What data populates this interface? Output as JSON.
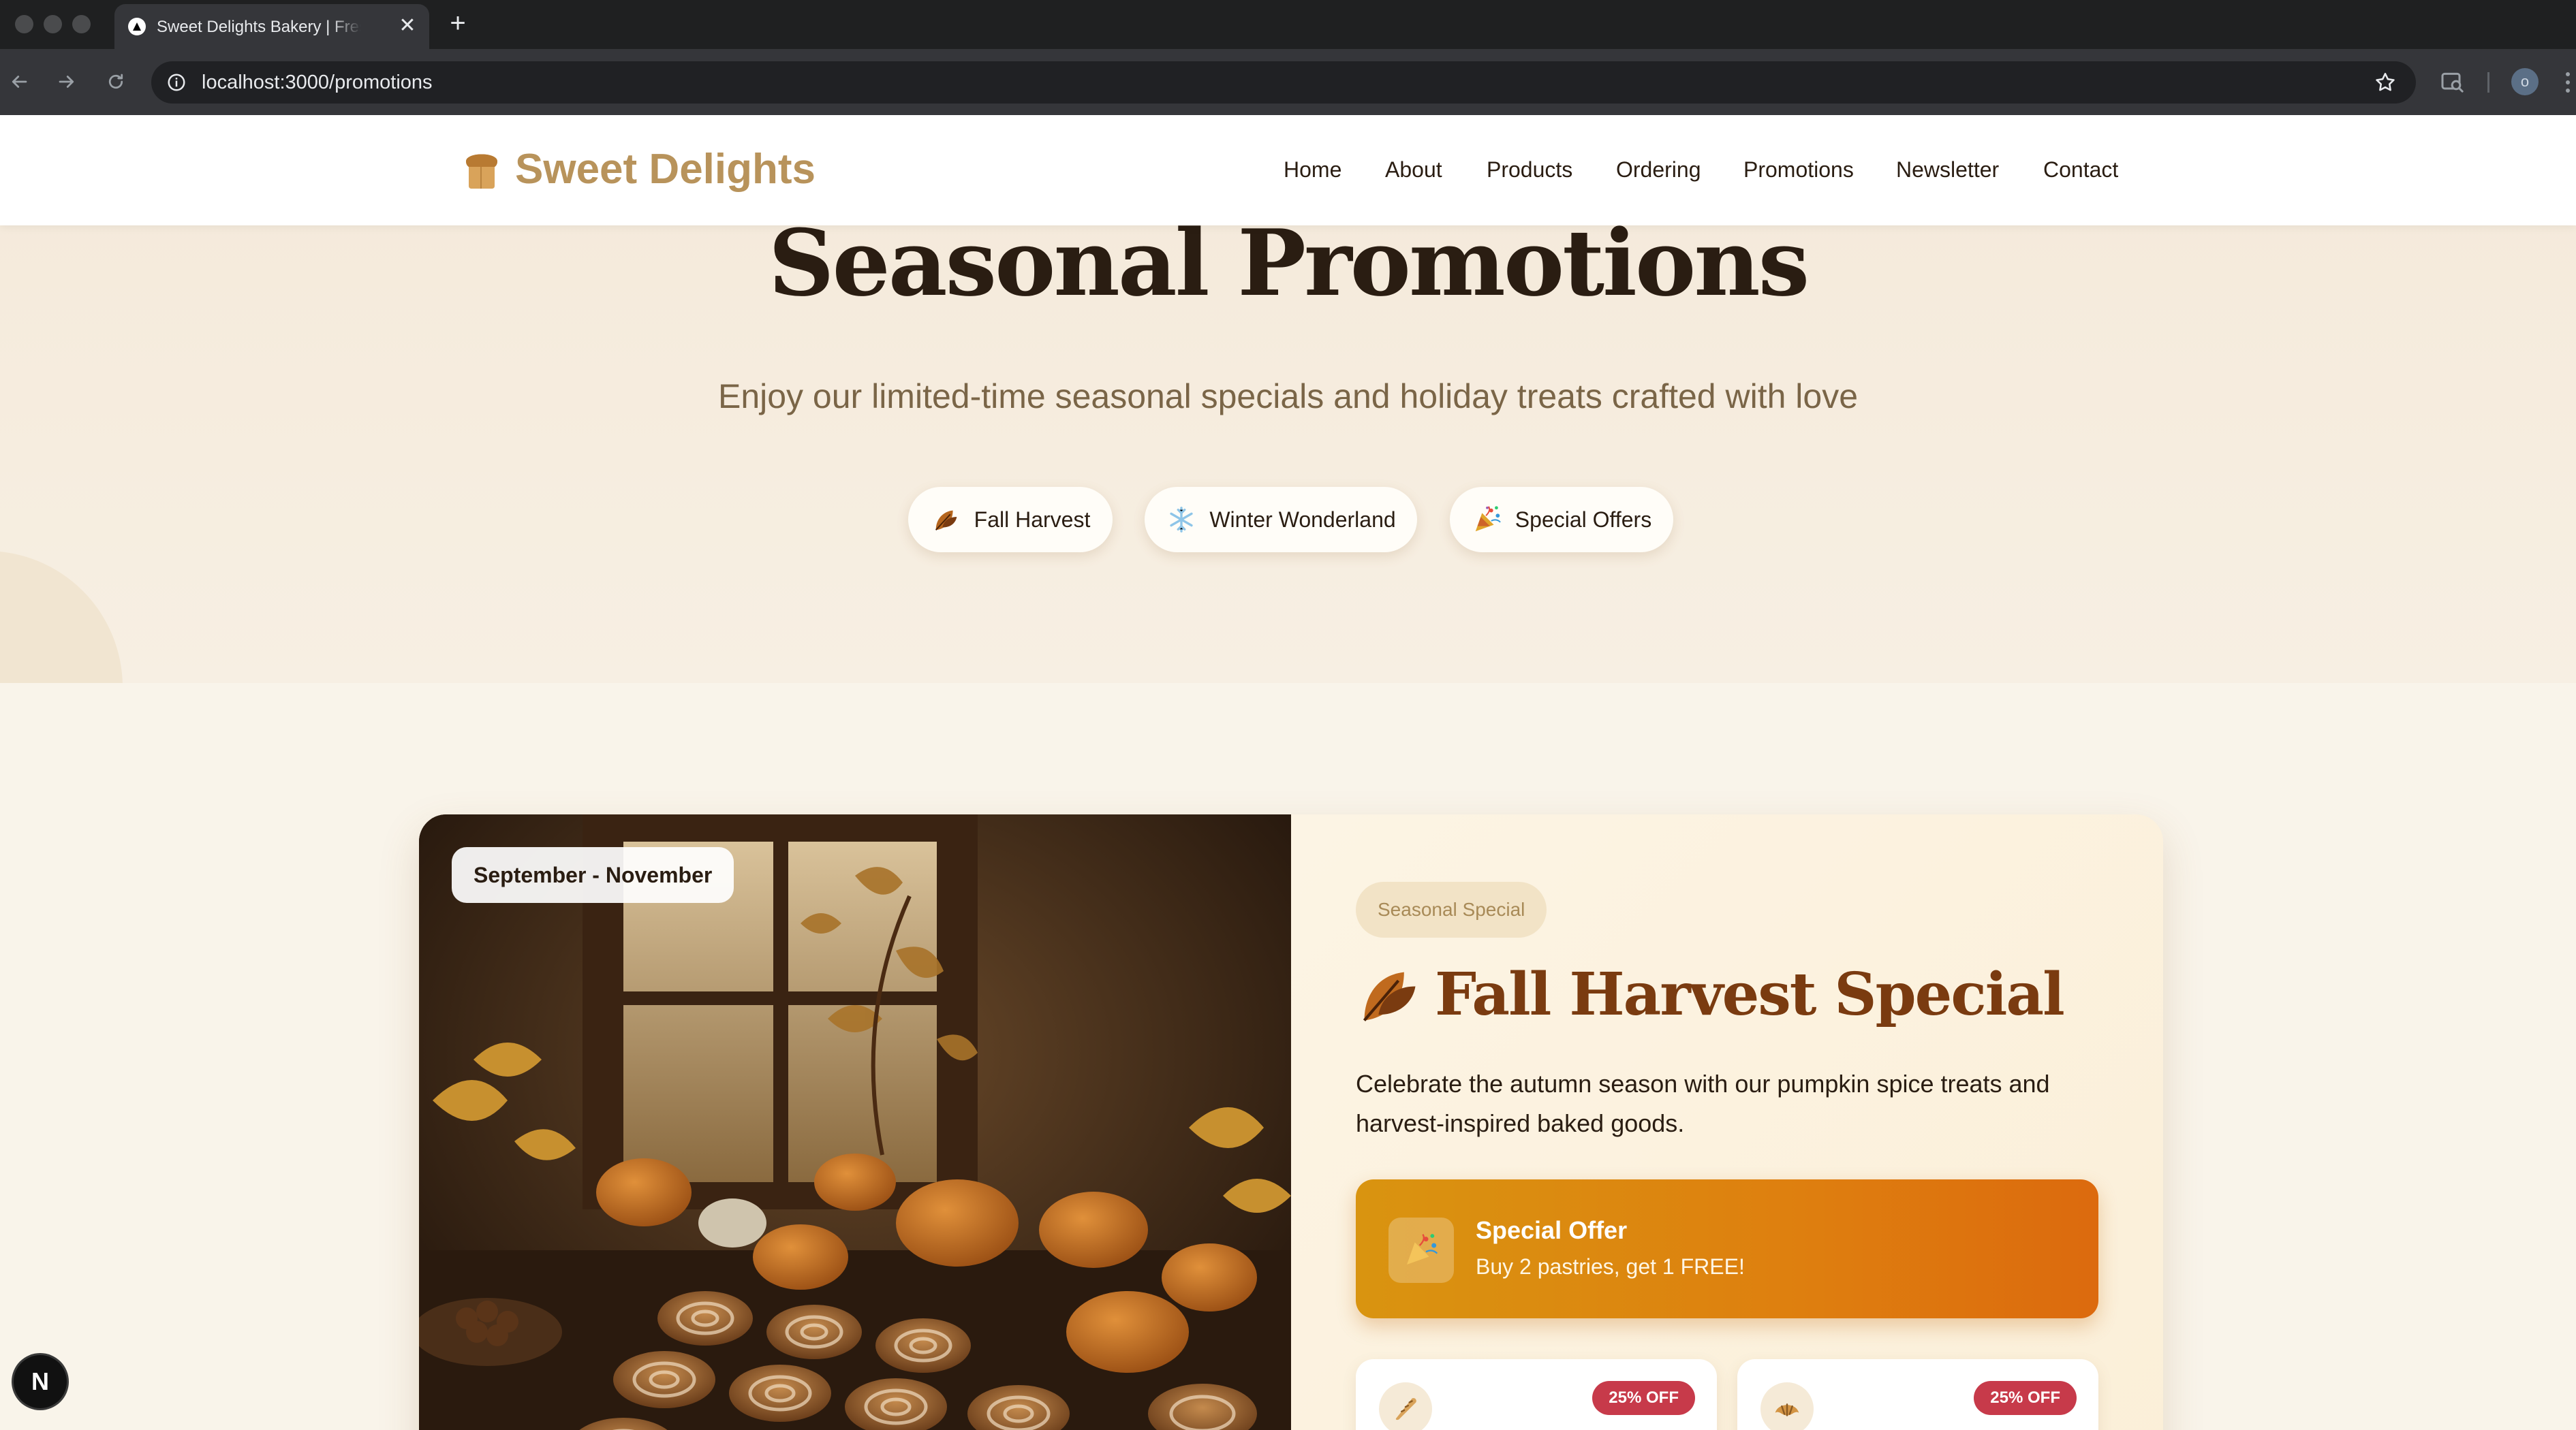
{
  "browser": {
    "tab_title": "Sweet Delights Bakery | Fresh Baked Goods",
    "tab_close": "✕",
    "new_tab": "+",
    "url": "localhost:3000/promotions",
    "profile_initial": "o"
  },
  "site": {
    "logo_text": "Sweet Delights",
    "nav": [
      "Home",
      "About",
      "Products",
      "Ordering",
      "Promotions",
      "Newsletter",
      "Contact"
    ]
  },
  "hero": {
    "title": "Seasonal Promotions",
    "subtitle": "Enjoy our limited-time seasonal specials and holiday treats crafted with love",
    "filters": [
      {
        "label": "Fall Harvest",
        "icon": "fallen-leaf-icon"
      },
      {
        "label": "Winter Wonderland",
        "icon": "snowflake-icon"
      },
      {
        "label": "Special Offers",
        "icon": "party-popper-icon"
      }
    ]
  },
  "promotion": {
    "date_range": "September - November",
    "tag": "Seasonal Special",
    "title": "Fall Harvest Special",
    "title_icon": "fallen-leaf-icon",
    "description": "Celebrate the autumn season with our pumpkin spice treats and harvest-inspired baked goods.",
    "offer": {
      "title": "Special Offer",
      "text": "Buy 2 pastries, get 1 FREE!",
      "icon": "party-popper-icon"
    },
    "products": [
      {
        "icon": "baguette-icon",
        "discount": "25% OFF"
      },
      {
        "icon": "croissant-icon",
        "discount": "25% OFF"
      }
    ]
  },
  "dev_indicator": "N",
  "colors": {
    "brand_gold": "#b8935b",
    "title_brown": "#7a3b10",
    "offer_orange": "#de7f0f",
    "badge_red": "#c73a4a",
    "hero_bg": "#f4e9da"
  }
}
